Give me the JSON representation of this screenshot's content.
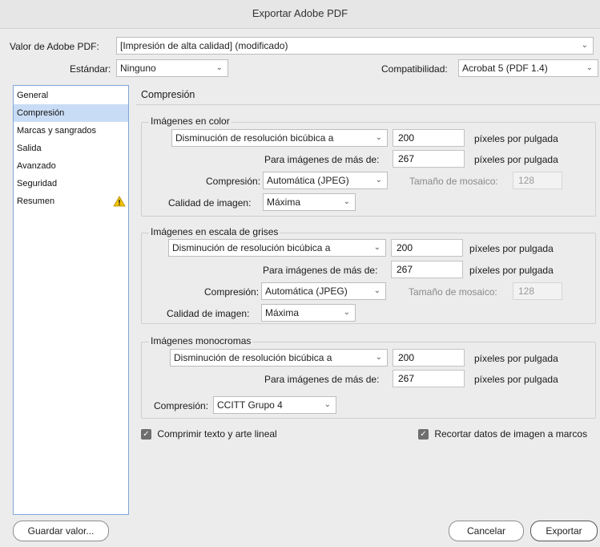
{
  "window": {
    "title": "Exportar Adobe PDF"
  },
  "preset": {
    "label": "Valor de Adobe PDF:",
    "value": "[Impresión de alta calidad] (modificado)"
  },
  "standard": {
    "label": "Estándar:",
    "value": "Ninguno"
  },
  "compat": {
    "label": "Compatibilidad:",
    "value": "Acrobat 5 (PDF 1.4)"
  },
  "sidebar": {
    "items": [
      {
        "label": "General"
      },
      {
        "label": "Compresión"
      },
      {
        "label": "Marcas y sangrados"
      },
      {
        "label": "Salida"
      },
      {
        "label": "Avanzado"
      },
      {
        "label": "Seguridad"
      },
      {
        "label": "Resumen"
      }
    ],
    "selected": "Compresión"
  },
  "panel": {
    "title": "Compresión"
  },
  "color": {
    "title": "Imágenes en color",
    "sampling": "Disminución de resolución bicúbica a",
    "ppi": "200",
    "ppi_unit": "píxeles por pulgada",
    "above_label": "Para imágenes de más de:",
    "above": "267",
    "above_unit": "píxeles por pulgada",
    "comp_label": "Compresión:",
    "comp": "Automática (JPEG)",
    "tile_label": "Tamaño de mosaico:",
    "tile": "128",
    "quality_label": "Calidad de imagen:",
    "quality": "Máxima"
  },
  "gray": {
    "title": "Imágenes en escala de grises",
    "sampling": "Disminución de resolución bicúbica a",
    "ppi": "200",
    "ppi_unit": "píxeles por pulgada",
    "above_label": "Para imágenes de más de:",
    "above": "267",
    "above_unit": "píxeles por pulgada",
    "comp_label": "Compresión:",
    "comp": "Automática (JPEG)",
    "tile_label": "Tamaño de mosaico:",
    "tile": "128",
    "quality_label": "Calidad de imagen:",
    "quality": "Máxima"
  },
  "mono": {
    "title": "Imágenes monocromas",
    "sampling": "Disminución de resolución bicúbica a",
    "ppi": "200",
    "ppi_unit": "píxeles por pulgada",
    "above_label": "Para imágenes de más de:",
    "above": "267",
    "above_unit": "píxeles por pulgada",
    "comp_label": "Compresión:",
    "comp": "CCITT Grupo 4"
  },
  "options": {
    "compress_text": {
      "label": "Comprimir texto y arte lineal",
      "checked": true
    },
    "crop_image": {
      "label": "Recortar datos de imagen a marcos",
      "checked": true
    }
  },
  "buttons": {
    "save_preset": "Guardar valor...",
    "cancel": "Cancelar",
    "export": "Exportar"
  },
  "icons": {
    "dropdown": "chevron-down-icon",
    "warning": "warning-icon",
    "check": "check-icon"
  },
  "colors": {
    "selection": "#c9dcf5",
    "sidebar_border": "#7ea6d8",
    "warning": "#f2c300"
  }
}
